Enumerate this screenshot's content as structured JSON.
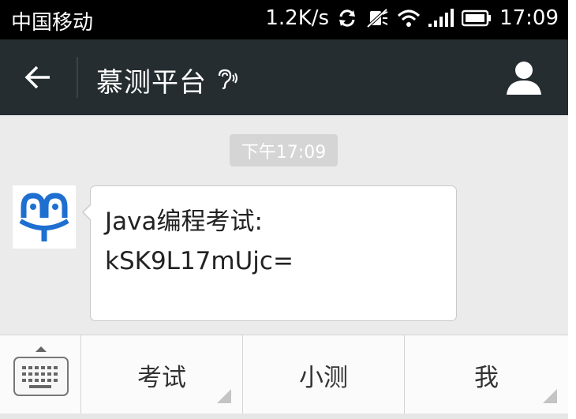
{
  "status_bar": {
    "carrier": "中国移动",
    "speed": "1.2K/s",
    "time": "17:09",
    "icons": [
      "sync-icon",
      "mute-icon",
      "wifi-icon",
      "signal-icon",
      "battery-icon"
    ]
  },
  "header": {
    "title": "慕测平台",
    "back_icon": "arrow-left-icon",
    "ear_icon": "ear-icon",
    "profile_icon": "person-icon"
  },
  "chat": {
    "timestamp": "下午17:09",
    "messages": [
      {
        "lines": [
          "Java编程考试:",
          "kSK9L17mUjc="
        ]
      }
    ]
  },
  "bottom_menu": {
    "keyboard_icon": "keyboard-icon",
    "items": [
      {
        "label": "考试"
      },
      {
        "label": "小测"
      },
      {
        "label": "我"
      }
    ]
  },
  "colors": {
    "status_bar_bg": "#000000",
    "header_bg": "#252d31",
    "chat_bg": "#ebebeb",
    "brand_blue": "#1e6fd0"
  }
}
